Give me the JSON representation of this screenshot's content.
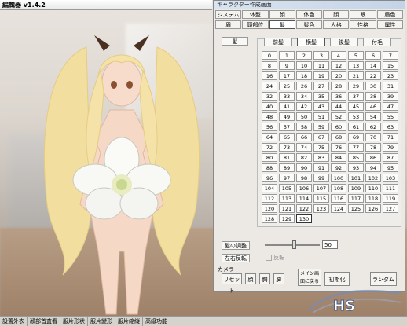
{
  "window": {
    "title": "編輯器 v1.4.2"
  },
  "dialog": {
    "title": "キャラクター作成画面",
    "tabs_row1": [
      "システム",
      "体型",
      "顔",
      "体色",
      "顔",
      "眼",
      "眉色"
    ],
    "tabs_row2": [
      "眉",
      "頭部位",
      "髪",
      "髪色",
      "人格",
      "性格",
      "属性"
    ],
    "side_label": "髪",
    "panel_tabs": [
      "前髪",
      "横髪",
      "後髪",
      "付毛"
    ],
    "selected_panel_tab": "横髪",
    "grid_values": [
      "0",
      "1",
      "2",
      "3",
      "4",
      "5",
      "6",
      "7",
      "8",
      "9",
      "10",
      "11",
      "12",
      "13",
      "14",
      "15",
      "16",
      "17",
      "18",
      "19",
      "20",
      "21",
      "22",
      "23",
      "24",
      "25",
      "26",
      "27",
      "28",
      "29",
      "30",
      "31",
      "32",
      "33",
      "34",
      "35",
      "36",
      "37",
      "38",
      "39",
      "40",
      "41",
      "42",
      "43",
      "44",
      "45",
      "46",
      "47",
      "48",
      "49",
      "50",
      "51",
      "52",
      "53",
      "54",
      "55",
      "56",
      "57",
      "58",
      "59",
      "60",
      "61",
      "62",
      "63",
      "64",
      "65",
      "66",
      "67",
      "68",
      "69",
      "70",
      "71",
      "72",
      "73",
      "74",
      "75",
      "76",
      "77",
      "78",
      "79",
      "80",
      "81",
      "82",
      "83",
      "84",
      "85",
      "86",
      "87",
      "88",
      "89",
      "90",
      "91",
      "92",
      "93",
      "94",
      "95",
      "96",
      "97",
      "98",
      "99",
      "100",
      "101",
      "102",
      "103",
      "104",
      "105",
      "106",
      "107",
      "108",
      "109",
      "110",
      "111",
      "112",
      "113",
      "114",
      "115",
      "116",
      "117",
      "118",
      "119",
      "120",
      "121",
      "122",
      "123",
      "124",
      "125",
      "126",
      "127",
      "128",
      "129",
      "130"
    ],
    "selected_value": "130",
    "hair_adjust_label": "髪の調整",
    "flip_label": "左右反転",
    "slider_value": "50",
    "checkbox_label": "反転",
    "camera_label": "カメラ",
    "camera_buttons": [
      "リセット",
      "顔",
      "胸",
      "脚"
    ],
    "menu_screen_button": "メイン画面に戻る",
    "save_button": "初期化",
    "random_button": "ランダム"
  },
  "statusbar": [
    "設置外衣",
    "顔部首査看",
    "服片形状",
    "服片變形",
    "服片縮縦",
    "高級功能"
  ],
  "logo_text": "HS"
}
